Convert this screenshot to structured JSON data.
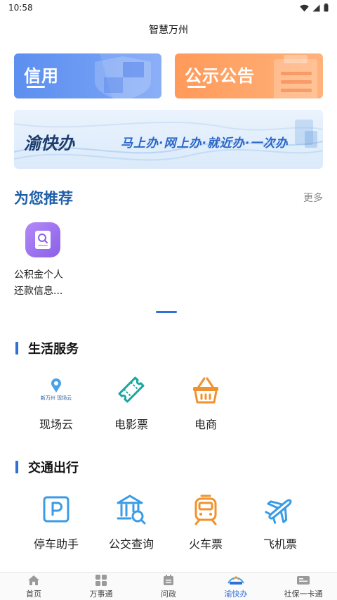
{
  "status_bar": {
    "time": "10:58"
  },
  "header": {
    "title": "智慧万州"
  },
  "banners": {
    "credit": {
      "title": "信用"
    },
    "notice": {
      "title": "公示公告"
    }
  },
  "slogan": {
    "logo": "渝快办",
    "text": "马上办·网上办·就近办·一次办"
  },
  "recommend": {
    "title": "为您推荐",
    "more": "更多",
    "items": [
      {
        "label_line1": "公积金个人",
        "label_line2": "还款信息..."
      }
    ]
  },
  "life_services": {
    "title": "生活服务",
    "items": [
      {
        "label": "现场云",
        "icon": "live-cloud-icon",
        "logo_text": "新万州 现场云"
      },
      {
        "label": "电影票",
        "icon": "movie-ticket-icon"
      },
      {
        "label": "电商",
        "icon": "shopping-basket-icon"
      }
    ]
  },
  "transport": {
    "title": "交通出行",
    "items": [
      {
        "label": "停车助手",
        "icon": "parking-icon"
      },
      {
        "label": "公交查询",
        "icon": "bus-query-icon"
      },
      {
        "label": "火车票",
        "icon": "train-icon"
      },
      {
        "label": "飞机票",
        "icon": "airplane-icon"
      }
    ]
  },
  "tab_bar": {
    "active": "渝快办",
    "items": [
      {
        "label": "首页",
        "icon": "home-icon"
      },
      {
        "label": "万事通",
        "icon": "grid-icon"
      },
      {
        "label": "问政",
        "icon": "calendar-icon"
      },
      {
        "label": "渝快办",
        "icon": "yukuaiban-icon"
      },
      {
        "label": "社保一卡通",
        "icon": "id-card-icon"
      }
    ]
  },
  "colors": {
    "accent": "#2e6fd9",
    "credit": "#5c8ff0",
    "notice": "#ff9a5a",
    "transport_icon": "#3a9be6",
    "life_icon": "#18a8a0"
  }
}
